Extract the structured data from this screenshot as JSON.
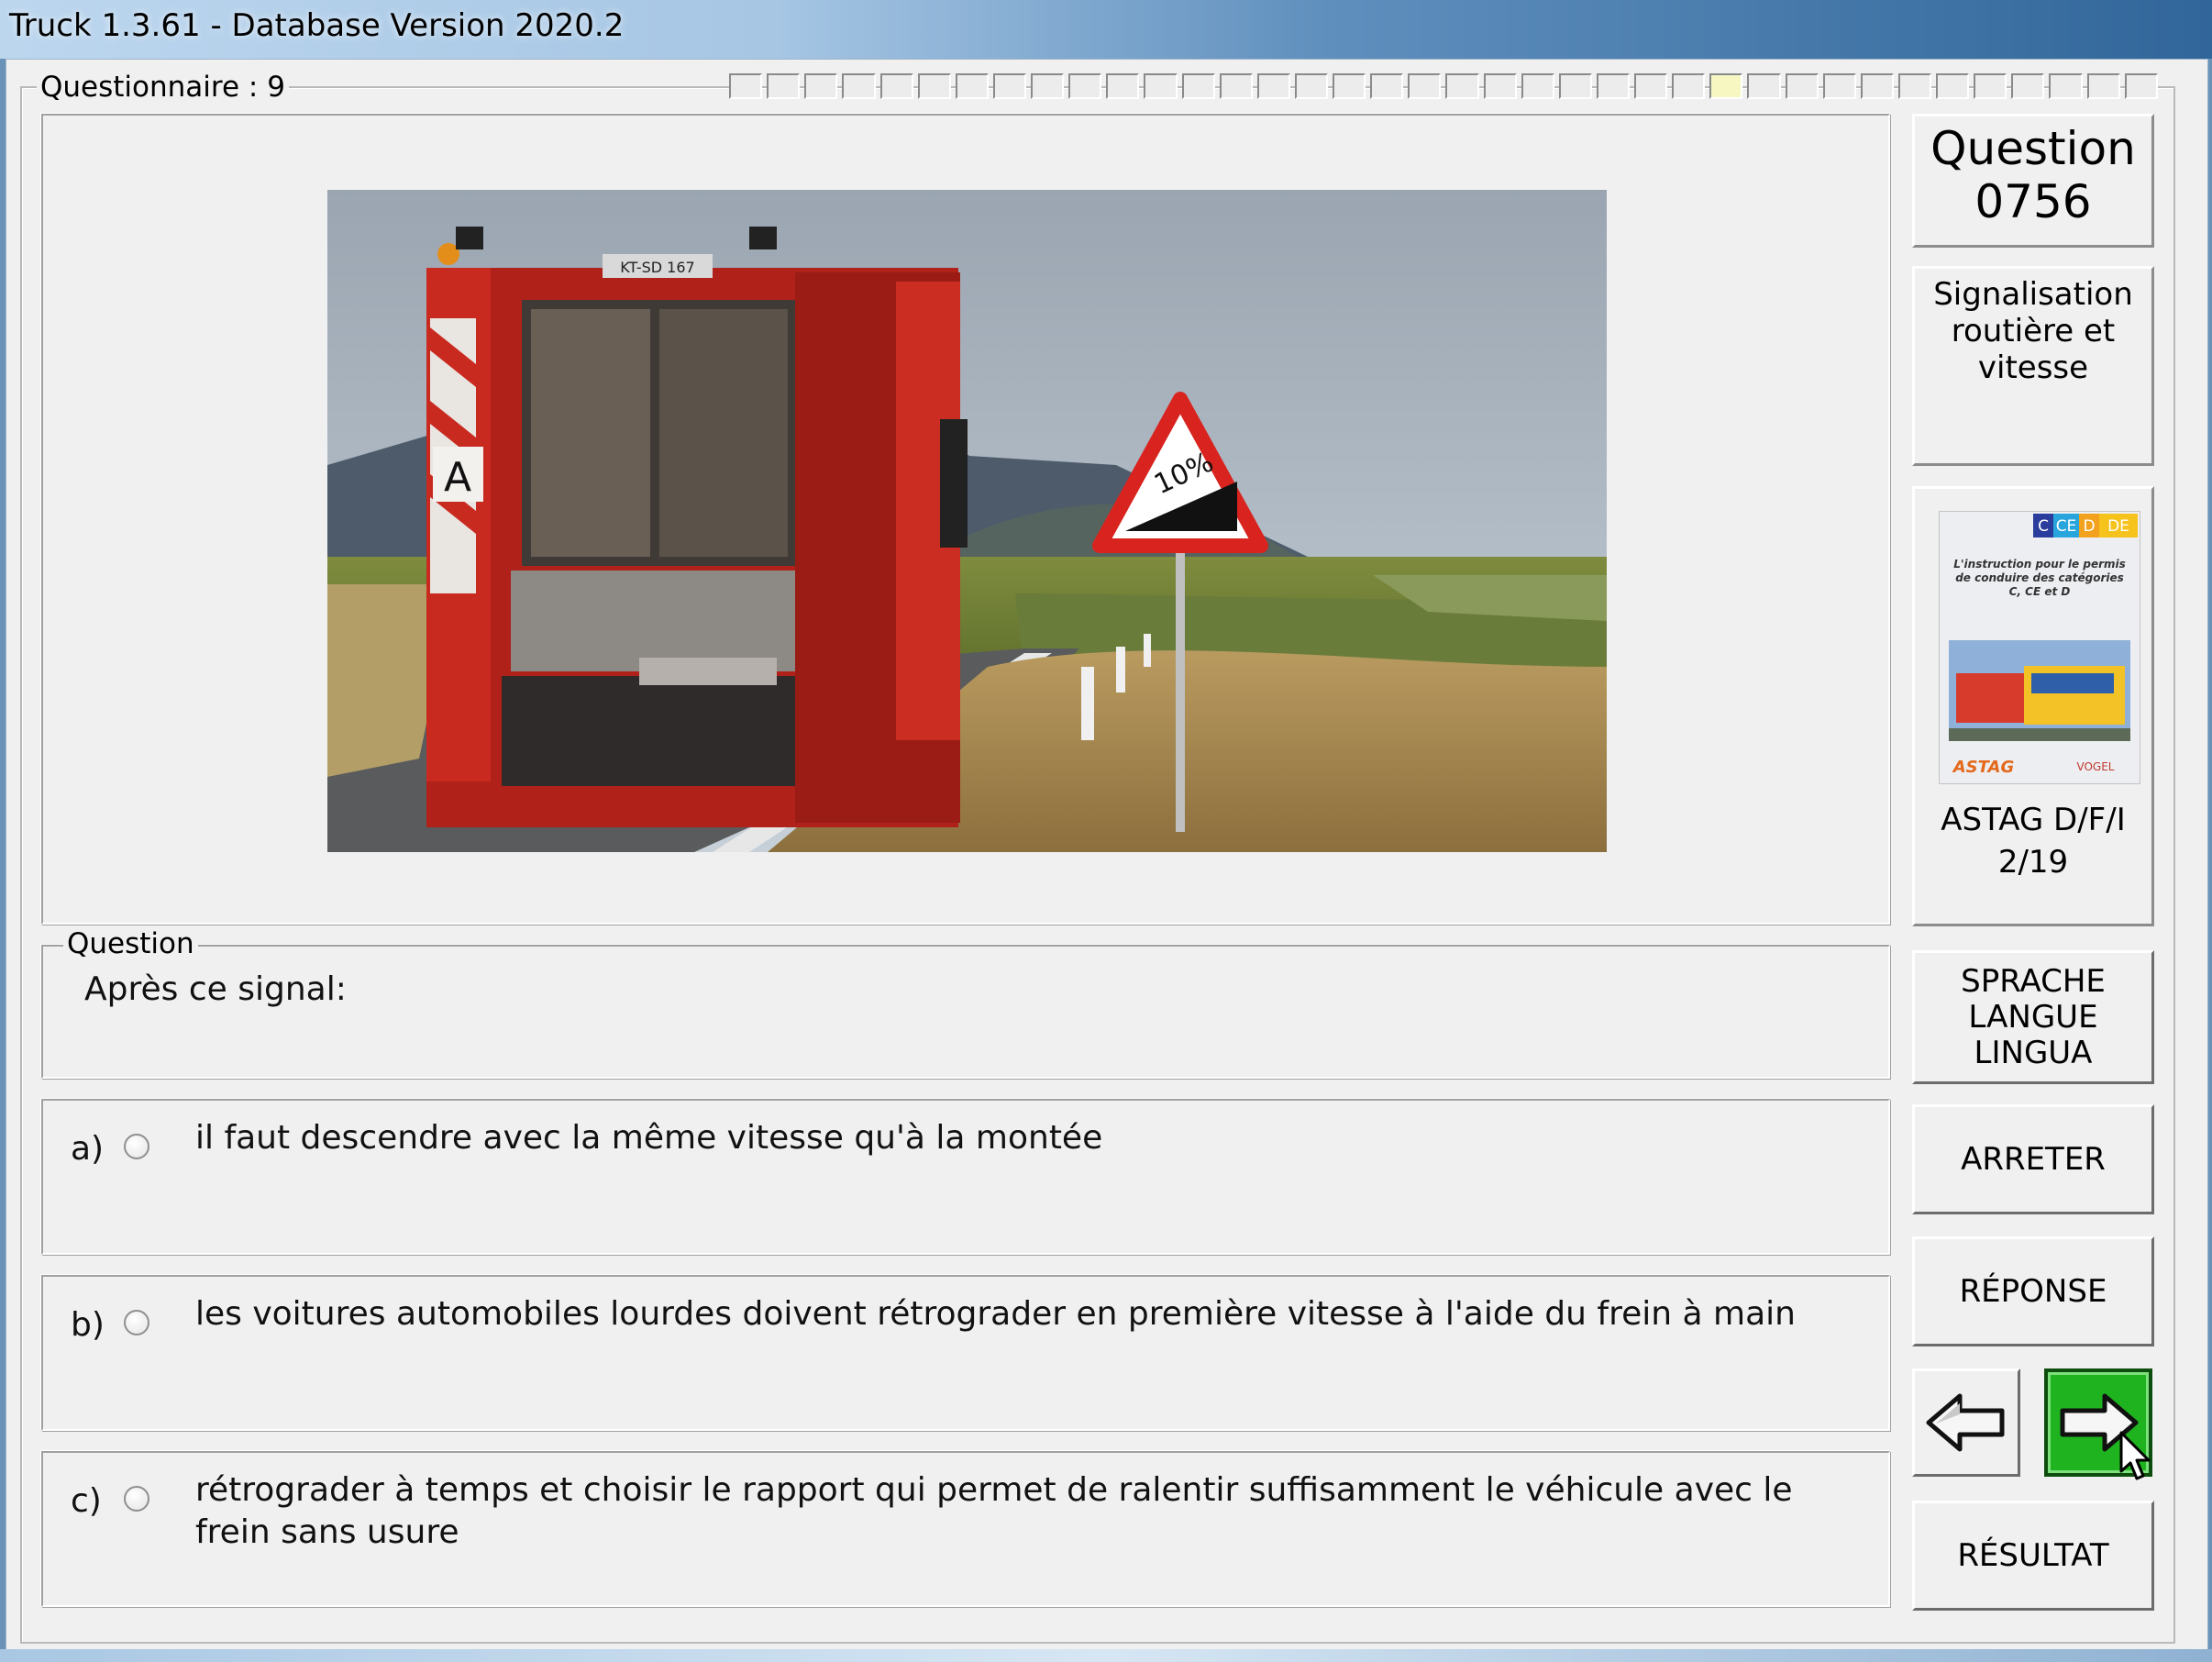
{
  "window": {
    "title": "Truck 1.3.61 - Database Version 2020.2"
  },
  "questionnaire": {
    "label": "Questionnaire : 9",
    "total_segments": 38,
    "current_segment": 26
  },
  "question": {
    "section_label": "Question",
    "text": "Après ce signal:",
    "number_title": "Question",
    "number": "0756",
    "category": "Signalisation\nroutière et vitesse"
  },
  "photo": {
    "sign_text": "10%",
    "truck_plate": "KT-SD 167",
    "truck_marking": "A"
  },
  "answers": [
    {
      "letter": "a)",
      "text": "il faut descendre avec la même vitesse qu'à la montée"
    },
    {
      "letter": "b)",
      "text": "les voitures automobiles lourdes doivent rétrograder en première vitesse à l'aide du frein à main"
    },
    {
      "letter": "c)",
      "text": "rétrograder à temps et choisir le rapport qui permet de ralentir suffisamment le véhicule avec le frein sans usure"
    }
  ],
  "book": {
    "badge_c": "C",
    "badge_ce": "CE",
    "badge_d": "D",
    "badge_de": "DE",
    "cover_text": "L'instruction pour le permis de conduire des catégories C, CE et D",
    "publisher": "ASTAG",
    "publisher2": "VOGEL",
    "ref_line1": "ASTAG D/F/I",
    "ref_line2": "2/19"
  },
  "buttons": {
    "language": "SPRACHE\nLANGUE\nLINGUA",
    "stop": "ARRETER",
    "answer": "RÉPONSE",
    "result": "RÉSULTAT"
  },
  "icons": {
    "back": "arrow-left-icon",
    "next": "arrow-right-icon",
    "cursor": "mouse-pointer-icon"
  },
  "colors": {
    "next_button": "#1fb31f",
    "title_gradient_end": "#31669a",
    "sign_red": "#d8231e"
  }
}
